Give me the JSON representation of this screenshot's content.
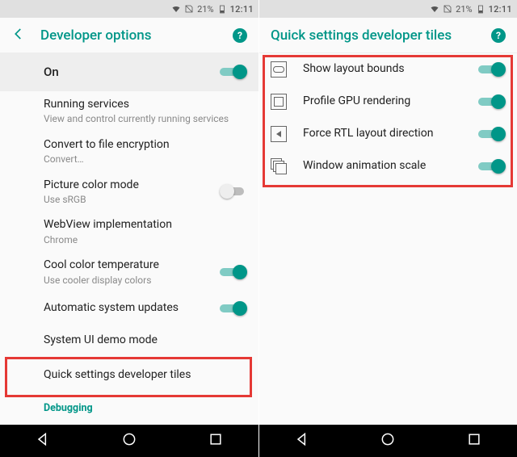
{
  "status": {
    "battery_pct": "21%",
    "time": "12:11"
  },
  "left": {
    "title": "Developer options",
    "master": {
      "label": "On",
      "on": true
    },
    "items": [
      {
        "label": "Running services",
        "sub": "View and control currently running services"
      },
      {
        "label": "Convert to file encryption",
        "sub": "Convert…"
      },
      {
        "label": "Picture color mode",
        "sub": "Use sRGB",
        "toggle": false
      },
      {
        "label": "WebView implementation",
        "sub": "Chrome"
      },
      {
        "label": "Cool color temperature",
        "sub": "Use cooler display colors",
        "toggle": true
      },
      {
        "label": "Automatic system updates",
        "toggle": true
      },
      {
        "label": "System UI demo mode"
      },
      {
        "label": "Quick settings developer tiles"
      }
    ],
    "section": "Debugging"
  },
  "right": {
    "title": "Quick settings developer tiles",
    "items": [
      {
        "label": "Show layout bounds",
        "toggle": true
      },
      {
        "label": "Profile GPU rendering",
        "toggle": true
      },
      {
        "label": "Force RTL layout direction",
        "toggle": true
      },
      {
        "label": "Window animation scale",
        "toggle": true
      }
    ]
  }
}
